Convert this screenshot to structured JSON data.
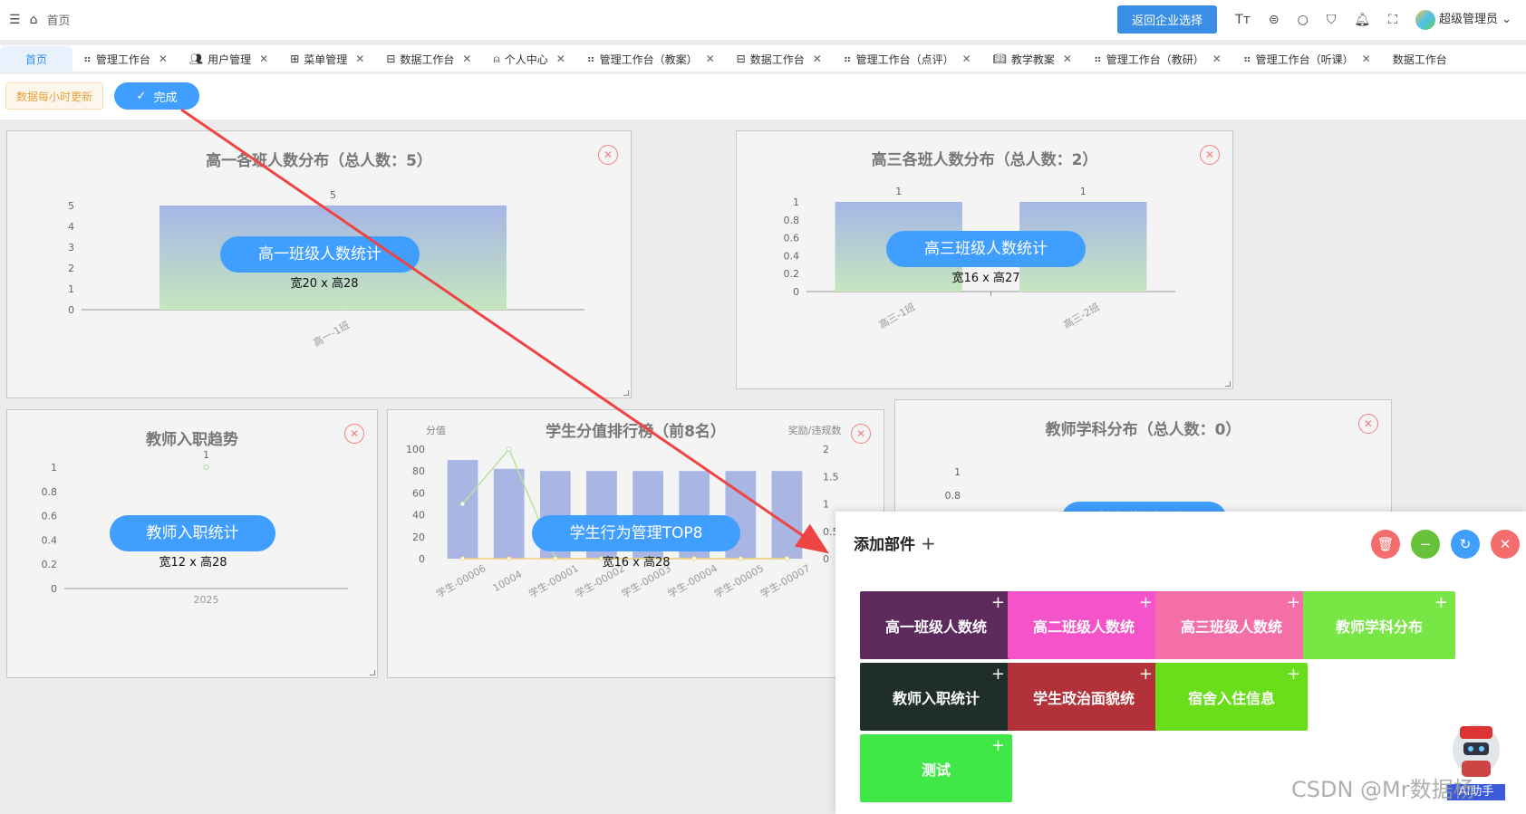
{
  "header": {
    "breadcrumb_home": "首页",
    "return_button": "返回企业选择",
    "font_icon": "Tт",
    "user_name": "超级管理员"
  },
  "tabs": [
    {
      "label": "首页",
      "active": true
    },
    {
      "label": "管理工作台"
    },
    {
      "label": "用户管理"
    },
    {
      "label": "菜单管理"
    },
    {
      "label": "数据工作台"
    },
    {
      "label": "个人中心"
    },
    {
      "label": "管理工作台（教案）"
    },
    {
      "label": "数据工作台"
    },
    {
      "label": "管理工作台（点评）"
    },
    {
      "label": "教学教案"
    },
    {
      "label": "管理工作台（教研）"
    },
    {
      "label": "管理工作台（听课）"
    },
    {
      "label": "数据工作台"
    }
  ],
  "toolbar": {
    "update_tag": "数据每小时更新",
    "done_button": "完成"
  },
  "cards": {
    "grade1": {
      "title": "高一各班人数分布（总人数：5）",
      "pill": "高一班级人数统计",
      "size": "宽20 x 高28"
    },
    "grade3": {
      "title": "高三各班人数分布（总人数：2）",
      "pill": "高三班级人数统计",
      "size": "宽16 x 高27"
    },
    "teacher_trend": {
      "title": "教师入职趋势",
      "pill": "教师入职统计",
      "size": "宽12 x 高28"
    },
    "student_rank": {
      "title": "学生分值排行榜（前8名）",
      "pill": "学生行为管理TOP8",
      "size": "宽16 x 高28"
    },
    "teacher_subject": {
      "title": "教师学科分布（总人数：0）",
      "pill": "教师学科分布"
    }
  },
  "chart_data": [
    {
      "type": "bar",
      "categories": [
        "高一-1班"
      ],
      "values": [
        5
      ],
      "ylim": [
        0,
        5
      ],
      "yticks": [
        "0",
        "1",
        "2",
        "3",
        "4",
        "5"
      ],
      "data_labels": [
        "5"
      ]
    },
    {
      "type": "bar",
      "categories": [
        "高三-1班",
        "高三-2班"
      ],
      "values": [
        1,
        1
      ],
      "ylim": [
        0,
        1
      ],
      "yticks": [
        "0",
        "0.2",
        "0.4",
        "0.6",
        "0.8",
        "1"
      ],
      "data_labels": [
        "1",
        "1"
      ]
    },
    {
      "type": "line",
      "categories": [
        "2025"
      ],
      "values": [
        1
      ],
      "ylim": [
        0,
        1
      ],
      "yticks": [
        "0",
        "0.2",
        "0.4",
        "0.6",
        "0.8",
        "1"
      ],
      "data_labels": [
        "1"
      ]
    },
    {
      "type": "bar",
      "categories": [
        "学生-00006",
        "10004",
        "学生-00001",
        "学生-00002",
        "学生-00003",
        "学生-00004",
        "学生-00005",
        "学生-00007"
      ],
      "ylabel": "分值",
      "ylabel_right": "奖励/违规数",
      "ylim": [
        0,
        100
      ],
      "ylim_right": [
        0,
        2
      ],
      "yticks": [
        "0",
        "20",
        "40",
        "60",
        "80",
        "100"
      ],
      "yticks_right": [
        "0",
        "0.5",
        "1",
        "1.5",
        "2"
      ],
      "series": [
        {
          "type": "bar",
          "values": [
            90,
            82,
            80,
            80,
            80,
            80,
            80,
            80
          ]
        },
        {
          "type": "line",
          "values": [
            1,
            2,
            0,
            0,
            0,
            0,
            0,
            0
          ]
        },
        {
          "type": "line",
          "values": [
            0,
            0,
            0,
            0,
            0,
            0,
            0,
            0
          ]
        }
      ]
    },
    {
      "type": "bar",
      "categories": [],
      "values": [],
      "yticks": [
        "1",
        "0.8"
      ]
    }
  ],
  "panel": {
    "title": "添加部件",
    "plus": "+",
    "widgets": [
      {
        "label": "高一班级人数统",
        "color": "#5e2a5e"
      },
      {
        "label": "高二班级人数统",
        "color": "#f553c9"
      },
      {
        "label": "高三班级人数统",
        "color": "#f46fa8"
      },
      {
        "label": "教师学科分布",
        "color": "#78e645"
      },
      {
        "label": "教师入职统计",
        "color": "#1f2e2a"
      },
      {
        "label": "学生政治面貌统",
        "color": "#b3323a"
      },
      {
        "label": "宿舍入住信息",
        "color": "#6ade1a"
      },
      {
        "label": "测试",
        "color": "#3fe846"
      }
    ]
  },
  "watermark": {
    "text": "CSDN @Mr数据杨",
    "ai_badge": "AI助手"
  }
}
